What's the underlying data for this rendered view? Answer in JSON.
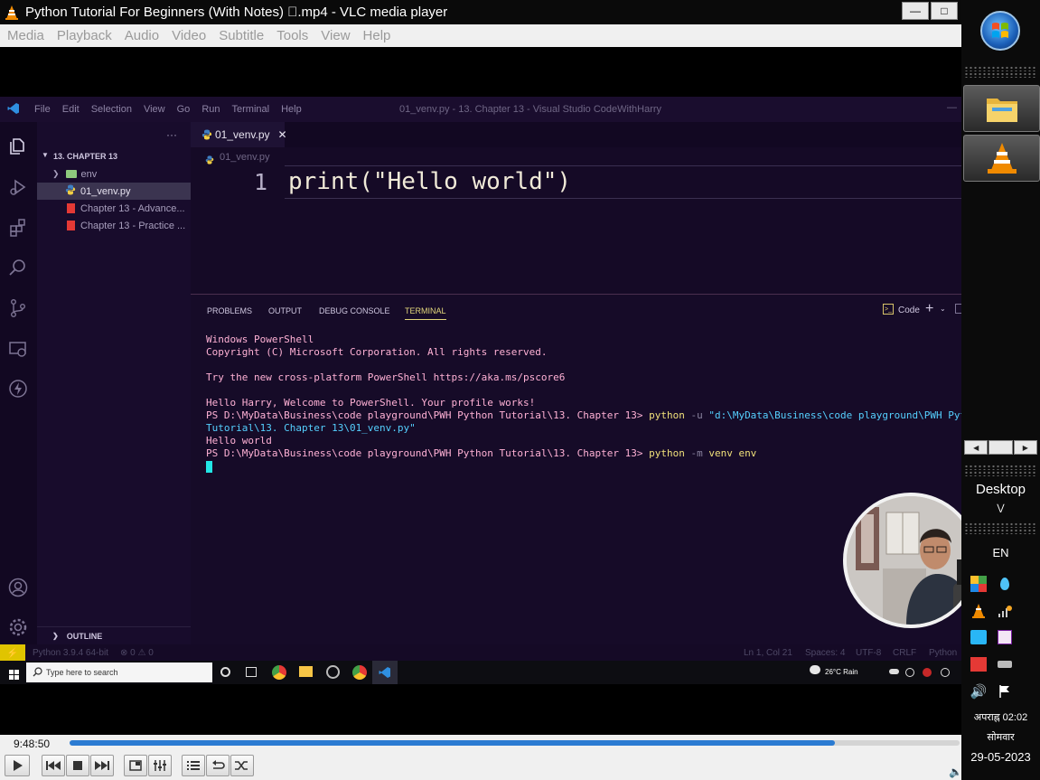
{
  "vlc": {
    "title": "Python Tutorial For Beginners (With Notes) \u0000.mp4 - VLC media player",
    "window_buttons": [
      "—",
      "□"
    ],
    "menu": [
      "Media",
      "Playback",
      "Audio",
      "Video",
      "Subtitle",
      "Tools",
      "View",
      "Help"
    ],
    "time": "9:48:50",
    "progress": 0.86
  },
  "vscode": {
    "menu": [
      "File",
      "Edit",
      "Selection",
      "View",
      "Go",
      "Run",
      "Terminal",
      "Help"
    ],
    "window_title": "01_venv.py - 13. Chapter 13 - Visual Studio CodeWithHarry",
    "sidebar": {
      "more": "···",
      "folder": "13. CHAPTER 13",
      "items": [
        "env",
        "01_venv.py",
        "Chapter 13 - Advance...",
        "Chapter 13 - Practice ..."
      ],
      "outline": "OUTLINE"
    },
    "tab": {
      "label": "01_venv.py",
      "close": "✕"
    },
    "breadcrumb": "01_venv.py",
    "editor": {
      "line_number": "1",
      "code": "print(\"Hello world\")"
    },
    "panel": {
      "tabs": [
        "PROBLEMS",
        "OUTPUT",
        "DEBUG CONSOLE",
        "TERMINAL"
      ],
      "shell_label": "Code",
      "terminal": {
        "l1": "Windows PowerShell",
        "l2": "Copyright (C) Microsoft Corporation. All rights reserved.",
        "l3": "Try the new cross-platform PowerShell https://aka.ms/pscore6",
        "l4": "Hello Harry, Welcome to PowerShell. Your profile works!",
        "prompt1": "PS D:\\MyData\\Business\\code playground\\PWH Python Tutorial\\13. Chapter 13> ",
        "cmd1": "python",
        "arg1": " -u ",
        "path1a": "\"d:\\MyData\\Business\\code playground\\PWH Python",
        "path1b": "Tutorial\\13. Chapter 13\\01_venv.py\"",
        "out1": "Hello world",
        "prompt2": "PS D:\\MyData\\Business\\code playground\\PWH Python Tutorial\\13. Chapter 13> ",
        "cmd2": "python",
        "arg2": " -m ",
        "rest2": "venv env"
      }
    },
    "status": {
      "remote": "⚡",
      "python": "Python 3.9.4 64-bit",
      "problems": "⊗ 0 ⚠ 0",
      "position": "Ln 1, Col 21",
      "spaces": "Spaces: 4",
      "encoding": "UTF-8",
      "eol": "CRLF",
      "language": "Python"
    }
  },
  "win_taskbar": {
    "search_placeholder": "Type here to search",
    "weather": "26°C Rain"
  },
  "right_taskbar": {
    "desktop": "Desktop",
    "lang": "EN",
    "time": "अपराह्न 02:02",
    "day": "सोमवार",
    "date": "29-05-2023"
  },
  "colors": {
    "vscode_bg": "#150a26",
    "terminal_text": "#ffb1d5",
    "seek_fill": "#2b7bd2",
    "remote_yellow": "#e0c400"
  }
}
